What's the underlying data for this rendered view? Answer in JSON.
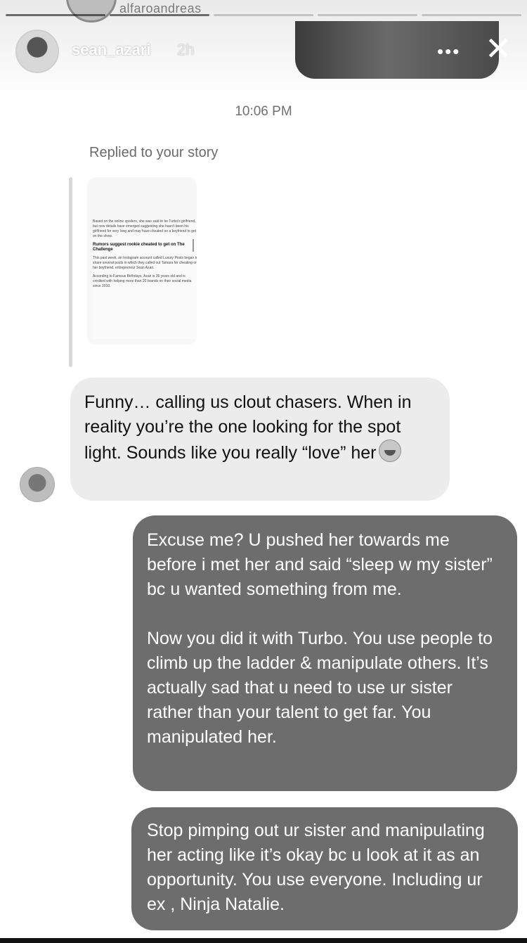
{
  "top": {
    "prev_username": "alfaroandreas"
  },
  "header": {
    "username": "sean_azari",
    "time_ago": "2h"
  },
  "chat": {
    "timestamp": "10:06 PM",
    "replied_label": "Replied to your story",
    "story_preview": {
      "para1": "Based on the online spoilers, she was said to be Turbo's girlfriend, but new details have emerged suggesting she hasn't been his girlfriend for very long and may have cheated on a boyfriend to get on the show.",
      "heading": "Rumors suggest rookie cheated to get on The Challenge",
      "para2": "This past week, an Instagram account called Luxury Posts began to share several posts in which they called out Tamara for cheating on her boyfriend, entrepreneur Sean Azari.",
      "para3": "According to Famous Birthdays, Azari is 35 years old and is credited with helping more than 20 brands on their social media since 2010."
    },
    "messages": [
      {
        "from": "them",
        "text": "Funny… calling us clout chasers. When in reality you’re the one looking for the spot light. Sounds like you really “love” her",
        "emoji": "laughing-crying"
      },
      {
        "from": "me",
        "para1": "Excuse me? U pushed her towards me before i met her and said “sleep w my sister” bc u wanted something from me.",
        "para2": "Now you did it with Turbo. You use people to climb up the ladder & manipulate others. It’s actually sad that u need to use ur sister rather than your talent to get far. You manipulated her."
      },
      {
        "from": "me",
        "text": "Stop pimping out ur sister and manipulating her acting like it’s okay bc u look at it as an opportunity. You use everyone. Including ur ex , Ninja Natalie."
      }
    ]
  },
  "colors": {
    "received_bubble": "#ececec",
    "sent_bubble": "#6d6d6d",
    "timestamp_text": "#6f6f6f"
  },
  "icons": [
    "more-icon",
    "close-icon",
    "laughing-crying-emoji"
  ]
}
